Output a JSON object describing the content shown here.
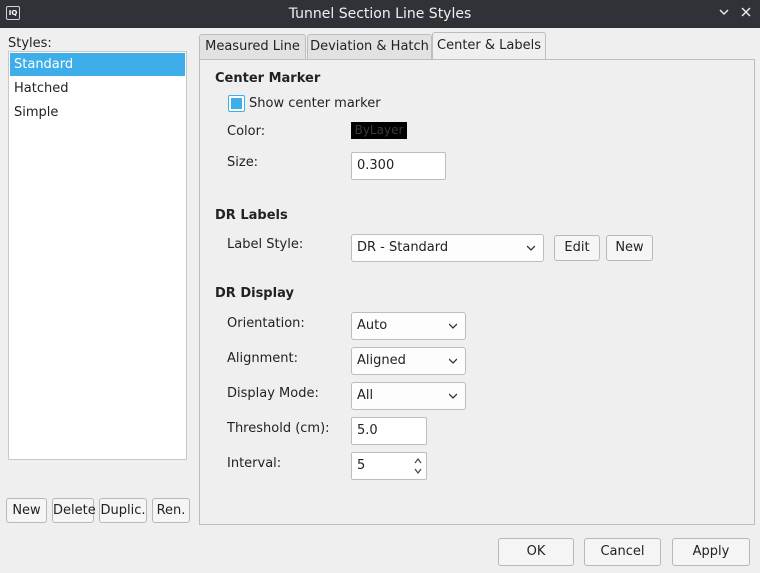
{
  "window": {
    "title": "Tunnel Section Line Styles",
    "app_icon_text": "IQ"
  },
  "styles": {
    "label": "Styles:",
    "items": [
      "Standard",
      "Hatched",
      "Simple"
    ],
    "selected": "Standard",
    "buttons": {
      "new": "New",
      "delete": "Delete",
      "duplicate": "Duplic.",
      "rename": "Ren."
    }
  },
  "tabs": [
    "Measured Line",
    "Deviation & Hatch",
    "Center & Labels"
  ],
  "active_tab": "Center & Labels",
  "center_marker": {
    "title": "Center Marker",
    "show_label": "Show center marker",
    "show_checked": true,
    "color_label": "Color:",
    "color_value": "ByLayer",
    "size_label": "Size:",
    "size_value": "0.300"
  },
  "dr_labels": {
    "title": "DR Labels",
    "label_style_label": "Label Style:",
    "label_style_value": "DR - Standard",
    "edit_button": "Edit",
    "new_button": "New"
  },
  "dr_display": {
    "title": "DR Display",
    "orientation_label": "Orientation:",
    "orientation_value": "Auto",
    "alignment_label": "Alignment:",
    "alignment_value": "Aligned",
    "display_mode_label": "Display Mode:",
    "display_mode_value": "All",
    "threshold_label": "Threshold (cm):",
    "threshold_value": "5.0",
    "interval_label": "Interval:",
    "interval_value": "5"
  },
  "footer": {
    "ok": "OK",
    "cancel": "Cancel",
    "apply": "Apply"
  },
  "colors": {
    "accent": "#3daee9",
    "titlebar": "#2f3338"
  }
}
